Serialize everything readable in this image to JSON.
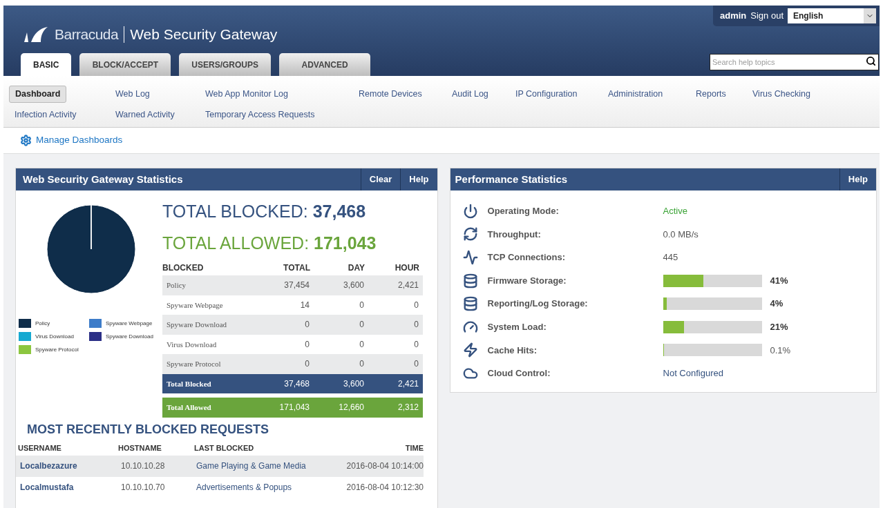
{
  "header": {
    "brand": "Barracuda",
    "product": "Web Security Gateway",
    "user": "admin",
    "sign_out": "Sign out",
    "language": "English",
    "search": {
      "placeholder": "Search help topics"
    }
  },
  "tabs": [
    {
      "label": "BASIC",
      "selected": true
    },
    {
      "label": "BLOCK/ACCEPT",
      "selected": false
    },
    {
      "label": "USERS/GROUPS",
      "selected": false
    },
    {
      "label": "ADVANCED",
      "selected": false
    }
  ],
  "subnav": [
    [
      {
        "label": "Dashboard",
        "selected": true
      },
      {
        "label": "Web Log",
        "selected": false
      },
      {
        "label": "Web App Monitor Log",
        "selected": false
      },
      {
        "label": "Remote Devices",
        "selected": false
      },
      {
        "label": "Audit Log",
        "selected": false
      },
      {
        "label": "IP Configuration",
        "selected": false
      },
      {
        "label": "Administration",
        "selected": false
      },
      {
        "label": "Reports",
        "selected": false
      },
      {
        "label": "Virus Checking",
        "selected": false
      }
    ],
    [
      {
        "label": "Infection Activity",
        "selected": false
      },
      {
        "label": "Warned Activity",
        "selected": false
      },
      {
        "label": "Temporary Access Requests",
        "selected": false
      }
    ]
  ],
  "manage_dashboards": "Manage Dashboards",
  "stats_panel": {
    "title": "Web Security Gateway Statistics",
    "buttons": [
      "Clear",
      "Help"
    ],
    "chart_data": {
      "type": "pie",
      "categories": [
        "Policy",
        "Spyware Webpage",
        "Virus Download",
        "Spyware Download",
        "Spyware Protocol"
      ],
      "values": [
        99.96,
        0.04,
        0,
        0,
        0
      ]
    },
    "legend": [
      {
        "color": "#0f2d4a"
      },
      {
        "color": "#3d7cc9"
      },
      {
        "color": "#16a9d1"
      },
      {
        "color": "#2b2f86"
      },
      {
        "color": "#8cc63f"
      }
    ],
    "total_blocked": {
      "label": "TOTAL BLOCKED:",
      "value": "37,468"
    },
    "total_allowed": {
      "label": "TOTAL ALLOWED:",
      "value": "171,043"
    },
    "table": {
      "columns": [
        "BLOCKED",
        "TOTAL",
        "DAY",
        "HOUR"
      ],
      "rows": [
        {
          "kind": "plain",
          "cells": [
            "Policy",
            "37,454",
            "3,600",
            "2,421"
          ]
        },
        {
          "kind": "plain",
          "cells": [
            "Spyware Webpage",
            "14",
            "0",
            "0"
          ]
        },
        {
          "kind": "plain",
          "cells": [
            "Spyware Download",
            "0",
            "0",
            "0"
          ]
        },
        {
          "kind": "plain",
          "cells": [
            "Virus Download",
            "0",
            "0",
            "0"
          ]
        },
        {
          "kind": "plain",
          "cells": [
            "Spyware Protocol",
            "0",
            "0",
            "0"
          ]
        },
        {
          "kind": "blocked",
          "cells": [
            "Total Blocked",
            "37,468",
            "3,600",
            "2,421"
          ]
        },
        {
          "kind": "allowed",
          "cells": [
            "Total Allowed",
            "171,043",
            "12,660",
            "2,312"
          ]
        }
      ]
    },
    "recent": {
      "title": "MOST RECENTLY BLOCKED REQUESTS",
      "columns": [
        "USERNAME",
        "HOSTNAME",
        "LAST BLOCKED",
        "TIME"
      ],
      "rows": [
        [
          "Localbezazure",
          "10.10.10.28",
          "Game Playing & Game Media",
          "2016-08-04 10:14:00"
        ],
        [
          "Localmustafa",
          "10.10.10.70",
          "Advertisements & Popups",
          "2016-08-04 10:12:30"
        ]
      ]
    }
  },
  "perf_panel": {
    "title": "Performance Statistics",
    "button": "Help",
    "rows": [
      {
        "label": "Operating Mode:",
        "kind": "status",
        "value": "Active"
      },
      {
        "label": "Throughput:",
        "kind": "text",
        "value": "0.0 MB/s"
      },
      {
        "label": "TCP Connections:",
        "kind": "text",
        "value": "445"
      },
      {
        "label": "Firmware Storage:",
        "kind": "bar",
        "level": 0.41,
        "value": "41%"
      },
      {
        "label": "Reporting/Log Storage:",
        "kind": "bar",
        "level": 0.04,
        "value": "4%"
      },
      {
        "label": "System Load:",
        "kind": "bar",
        "level": 0.21,
        "value": "21%"
      },
      {
        "label": "Cache Hits:",
        "kind": "bar",
        "level": 0.001,
        "value": "0.1%"
      },
      {
        "label": "Cloud Control:",
        "kind": "link",
        "value": "Not Configured"
      }
    ]
  }
}
